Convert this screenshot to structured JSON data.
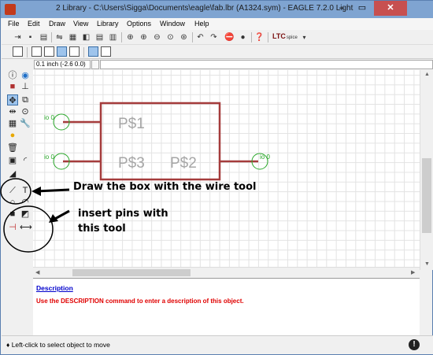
{
  "window": {
    "title": "2 Library - C:\\Users\\Sigga\\Documents\\eagle\\fab.lbr (A1324.sym) - EAGLE 7.2.0 Light",
    "min": "–",
    "max": "▭",
    "close": "✕"
  },
  "menu": [
    {
      "label": "File"
    },
    {
      "label": "Edit"
    },
    {
      "label": "Draw"
    },
    {
      "label": "View"
    },
    {
      "label": "Library"
    },
    {
      "label": "Options"
    },
    {
      "label": "Window"
    },
    {
      "label": "Help"
    }
  ],
  "toolbar": {
    "ltc_label": "LTC",
    "ltc_sub": "spice"
  },
  "cmdline": {
    "coord": "0.1 inch (-2.6 0.0)",
    "value": ""
  },
  "symbol": {
    "pins": [
      {
        "name": "P$1",
        "label": "io 0"
      },
      {
        "name": "P$3",
        "label": "io 0"
      },
      {
        "name": "P$2",
        "label": "io 0"
      }
    ]
  },
  "annotations": {
    "wire_tool": "Draw the box with the wire tool",
    "pin_tool_line1": "insert pins with",
    "pin_tool_line2": "this tool"
  },
  "description": {
    "link": "Description",
    "text": "Use the DESCRIPTION command to enter a description of this object."
  },
  "status": {
    "text": "♦ Left-click to select object to move",
    "stop": "!"
  },
  "colors": {
    "symbol_line": "#a53c3c",
    "pin_green": "#2aa82a",
    "text_gray": "#a6a6a6",
    "title_bar": "#7fa4d1",
    "desc_red": "#e00000"
  }
}
